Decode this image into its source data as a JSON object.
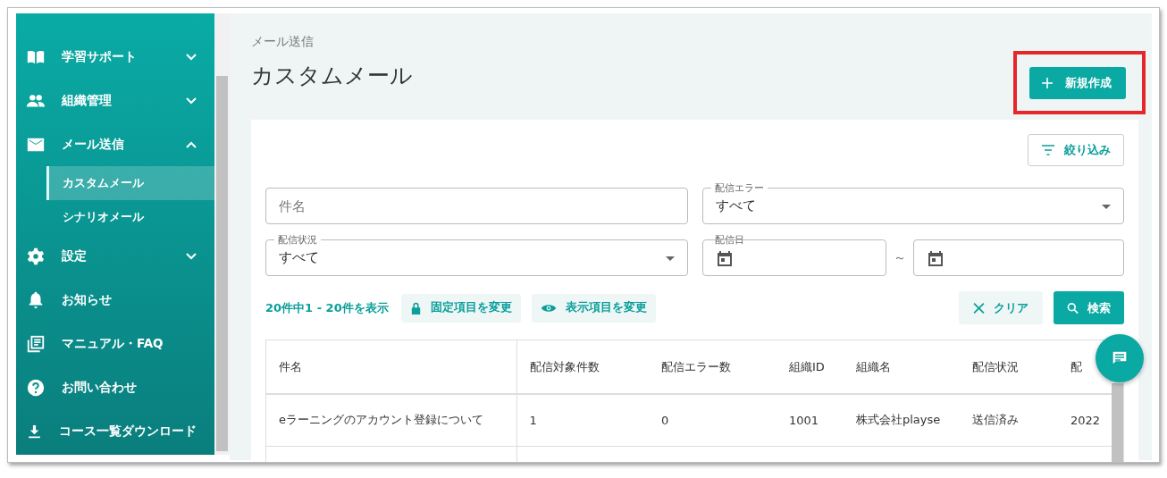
{
  "sidebar": {
    "items": [
      {
        "label": "学習サポート",
        "expanded": false
      },
      {
        "label": "組織管理",
        "expanded": false
      },
      {
        "label": "メール送信",
        "expanded": true,
        "children": [
          {
            "label": "カスタムメール",
            "selected": true
          },
          {
            "label": "シナリオメール",
            "selected": false
          }
        ]
      },
      {
        "label": "設定",
        "expanded": false
      },
      {
        "label": "お知らせ"
      },
      {
        "label": "マニュアル・FAQ"
      },
      {
        "label": "お問い合わせ"
      },
      {
        "label": "コース一覧ダウンロード"
      }
    ]
  },
  "breadcrumb": "メール送信",
  "title": "カスタムメール",
  "new_button": "新規作成",
  "filter_button": "絞り込み",
  "fields": {
    "subject": {
      "placeholder": "件名"
    },
    "error": {
      "label": "配信エラー",
      "value": "すべて"
    },
    "status": {
      "label": "配信状況",
      "value": "すべて"
    },
    "date": {
      "label": "配信日",
      "separator": "～"
    }
  },
  "count": "20件中1 - 20件を表示",
  "fixed_button": "固定項目を変更",
  "display_button": "表示項目を変更",
  "clear_button": "クリア",
  "search_button": "検索",
  "table": {
    "columns": [
      "件名",
      "配信対象件数",
      "配信エラー数",
      "組織ID",
      "組織名",
      "配信状況",
      "配"
    ],
    "rows": [
      [
        "eラーニングのアカウント登録について",
        "1",
        "0",
        "1001",
        "株式会社playse",
        "送信済み",
        "2022"
      ]
    ]
  }
}
